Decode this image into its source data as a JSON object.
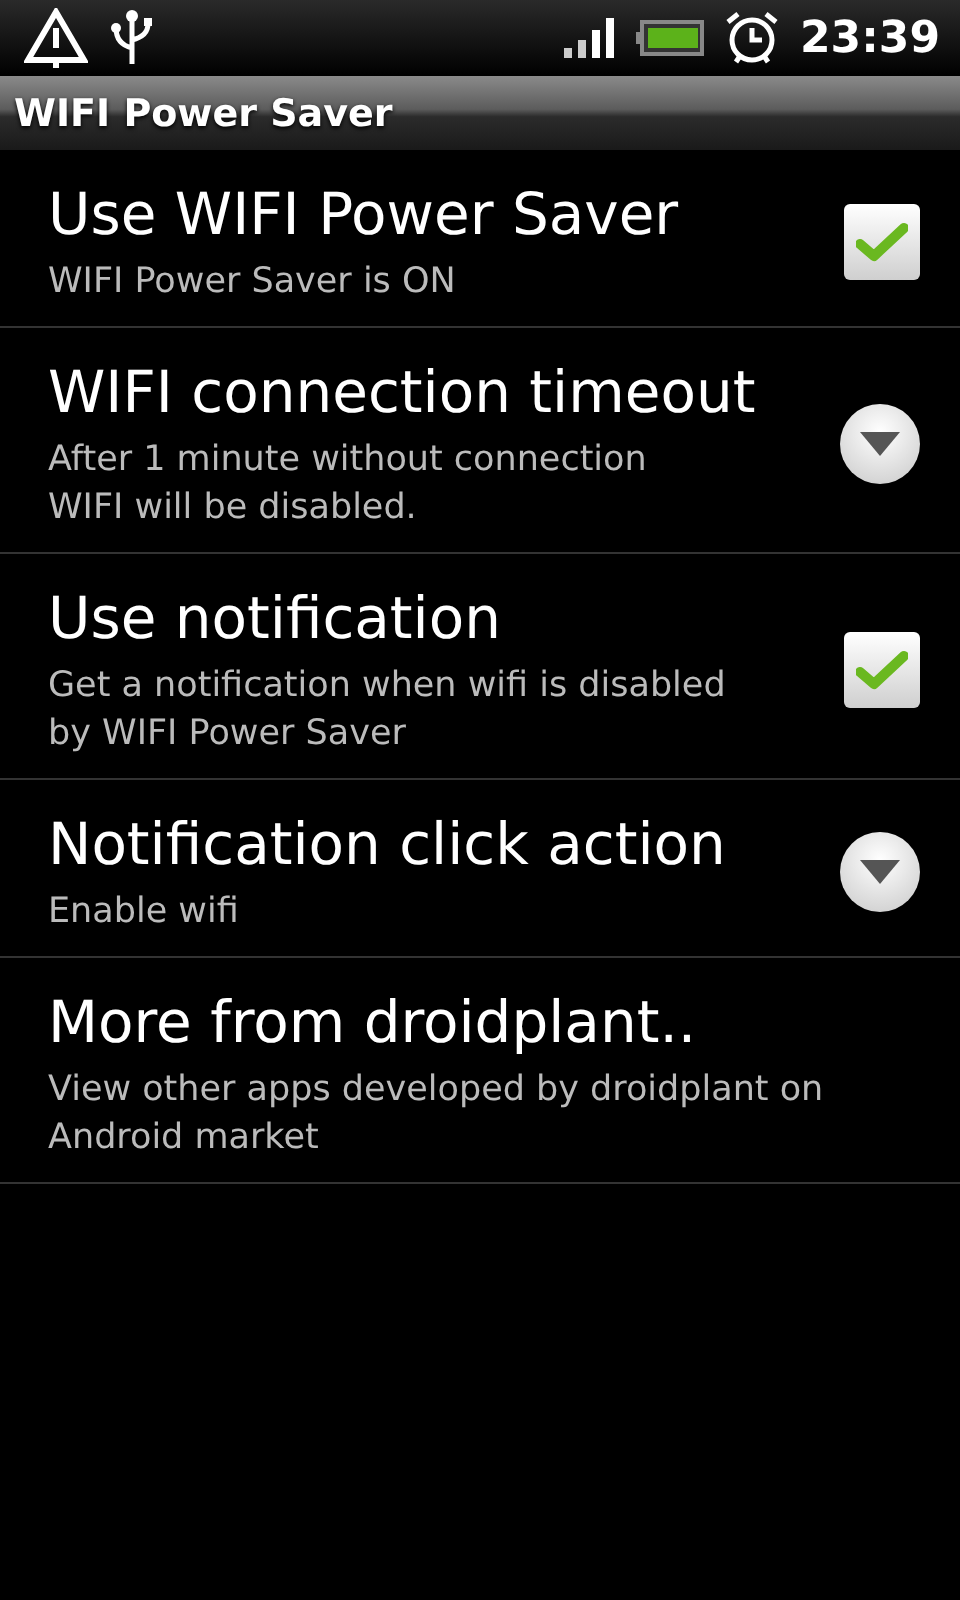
{
  "status_bar": {
    "time": "23:39"
  },
  "title_bar": {
    "title": "WIFI Power Saver"
  },
  "preferences": [
    {
      "kind": "checkbox",
      "title": "Use WIFI Power Saver",
      "summary": "WIFI Power Saver is ON",
      "checked": true
    },
    {
      "kind": "dropdown",
      "title": "WIFI connection timeout",
      "summary": "After 1 minute without connection\nWIFI will be disabled."
    },
    {
      "kind": "checkbox",
      "title": "Use notification",
      "summary": "Get a notification when wifi is disabled\nby WIFI Power Saver",
      "checked": true
    },
    {
      "kind": "dropdown",
      "title": "Notification click action",
      "summary": "Enable wifi"
    },
    {
      "kind": "plain",
      "title": "More from droidplant..",
      "summary": "View other apps developed by droidplant on\nAndroid market"
    }
  ]
}
